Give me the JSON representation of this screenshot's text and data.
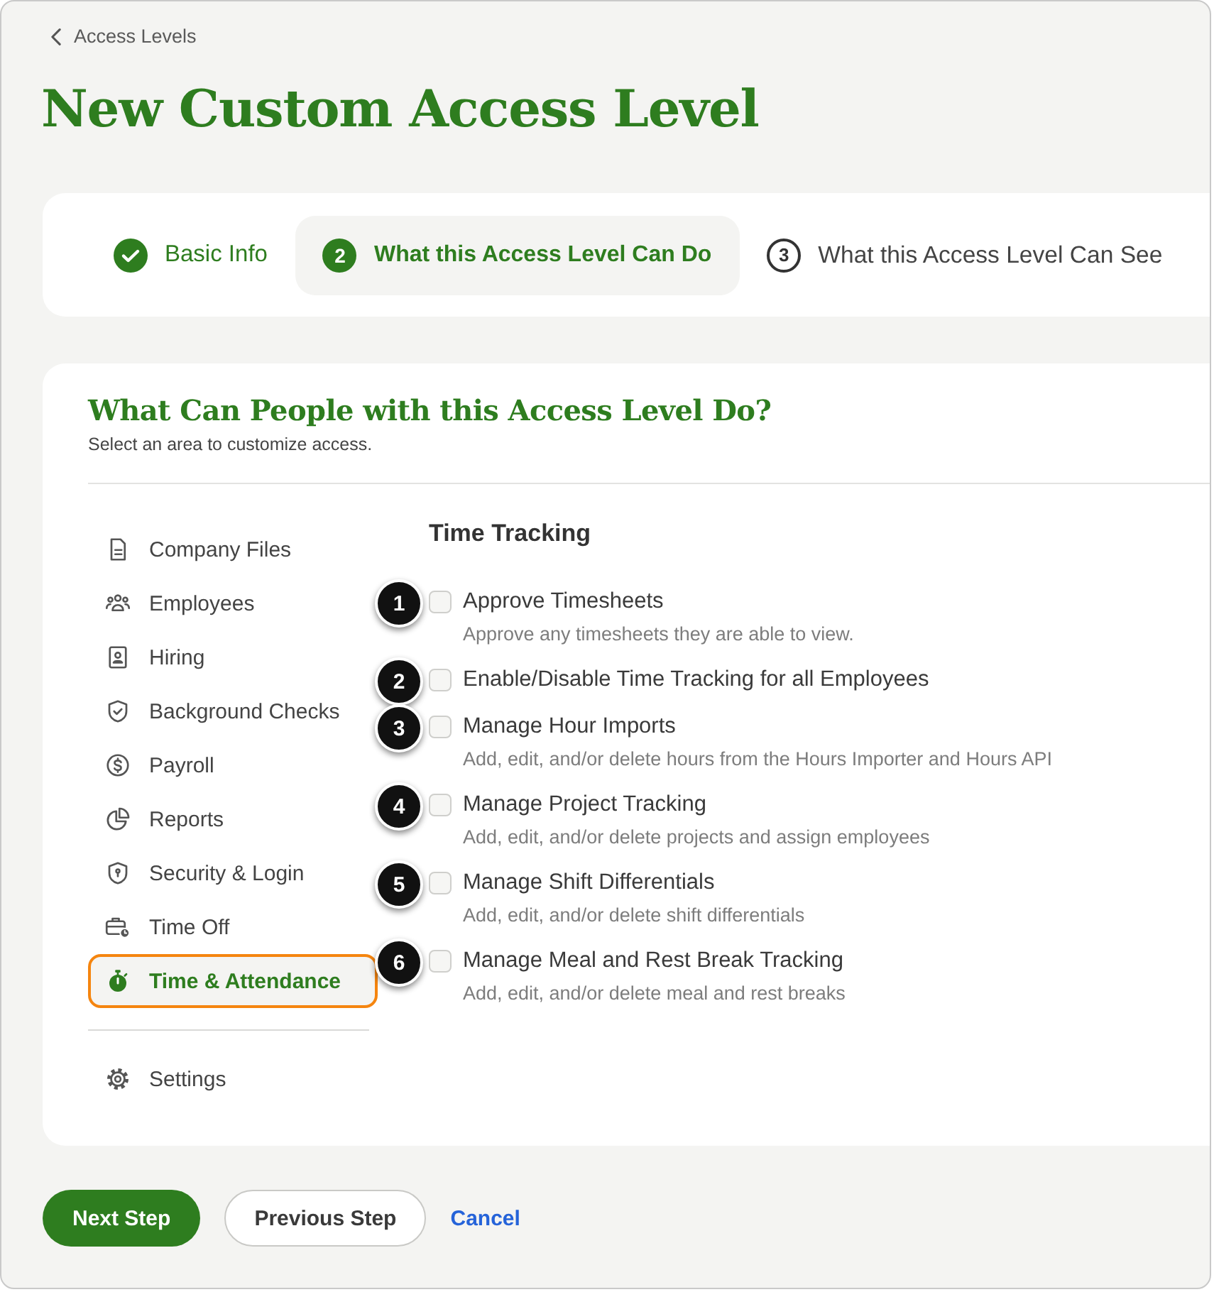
{
  "breadcrumb": {
    "label": "Access Levels"
  },
  "title": "New Custom Access Level",
  "steps": [
    {
      "completed": true,
      "selected": false,
      "label": "Basic Info"
    },
    {
      "completed": false,
      "selected": true,
      "number": "2",
      "label": "What this Access Level Can Do"
    },
    {
      "completed": false,
      "selected": false,
      "number": "3",
      "label": "What this Access Level Can See"
    }
  ],
  "panel": {
    "heading": "What Can People with this Access Level Do?",
    "subheading": "Select an area to customize access.",
    "areas": [
      {
        "label": "Company Files",
        "selected": false,
        "highlighted": false
      },
      {
        "label": "Employees",
        "selected": false,
        "highlighted": false
      },
      {
        "label": "Hiring",
        "selected": false,
        "highlighted": false
      },
      {
        "label": "Background Checks",
        "selected": false,
        "highlighted": false
      },
      {
        "label": "Payroll",
        "selected": false,
        "highlighted": false
      },
      {
        "label": "Reports",
        "selected": false,
        "highlighted": false
      },
      {
        "label": "Security & Login",
        "selected": false,
        "highlighted": false
      },
      {
        "label": "Time Off",
        "selected": false,
        "highlighted": false
      },
      {
        "label": "Time & Attendance",
        "selected": true,
        "highlighted": true
      }
    ],
    "settings": {
      "label": "Settings",
      "selected": false
    },
    "section_title": "Time Tracking",
    "permissions": [
      {
        "callout": "1",
        "label": "Approve Timesheets",
        "description": "Approve any timesheets they are able to view.",
        "checked": false
      },
      {
        "callout": "2",
        "label": "Enable/Disable Time Tracking for all Employees",
        "checked": false
      },
      {
        "callout": "3",
        "label": "Manage Hour Imports",
        "description": "Add, edit, and/or delete hours from the Hours Importer and Hours API",
        "checked": false
      },
      {
        "callout": "4",
        "label": "Manage Project Tracking",
        "description": "Add, edit, and/or delete projects and assign employees",
        "checked": false
      },
      {
        "callout": "5",
        "label": "Manage Shift Differentials",
        "description": "Add, edit, and/or delete shift differentials",
        "checked": false
      },
      {
        "callout": "6",
        "label": "Manage Meal and Rest Break Tracking",
        "description": "Add, edit, and/or delete meal and rest breaks",
        "checked": false
      }
    ]
  },
  "actions": {
    "next": "Next Step",
    "previous": "Previous Step",
    "cancel": "Cancel"
  }
}
